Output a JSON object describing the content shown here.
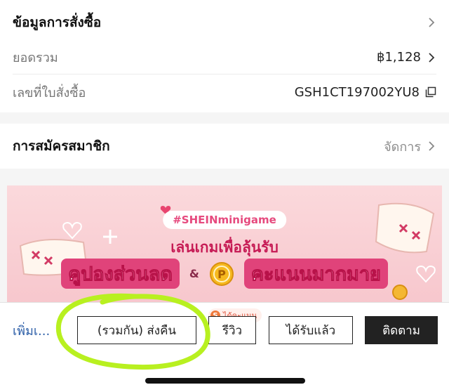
{
  "order_info": {
    "title": "ข้อมูลการสั่งซื้อ",
    "total_label": "ยอดรวม",
    "total_value": "฿1,128",
    "order_number_label": "เลขที่ใบสั่งซื้อ",
    "order_number_value": "GSH1CT197002YU8"
  },
  "membership": {
    "title": "การสมัครสมาชิก",
    "action_label": "จัดการ"
  },
  "banner": {
    "hashtag": "#SHEINminigame",
    "line1": "เล่นเกมเพื่อลุ้นรับ",
    "word_left": "คูปองส่วนลด",
    "ampersand": "&",
    "word_right": "คะแนนมากมาย",
    "background": "#f8cdd2",
    "accent": "#e0437a"
  },
  "bottom_bar": {
    "more_label": "เพิ่มเ...",
    "return_button": "(รวมกัน) ส่งคืน",
    "review_button": "รีวิว",
    "points_badge_icon": "S",
    "points_badge_text": "ได้คะแนน",
    "received_button": "ได้รับแล้ว",
    "track_button": "ติดตาม"
  },
  "colors": {
    "link": "#2d5fa8",
    "annotation_highlight": "#b8f020",
    "primary_button": "#222222"
  },
  "icons": {
    "chevron": "chevron-right-icon",
    "copy": "copy-icon",
    "heart": "heart-icon",
    "coin": "points-coin-icon"
  }
}
